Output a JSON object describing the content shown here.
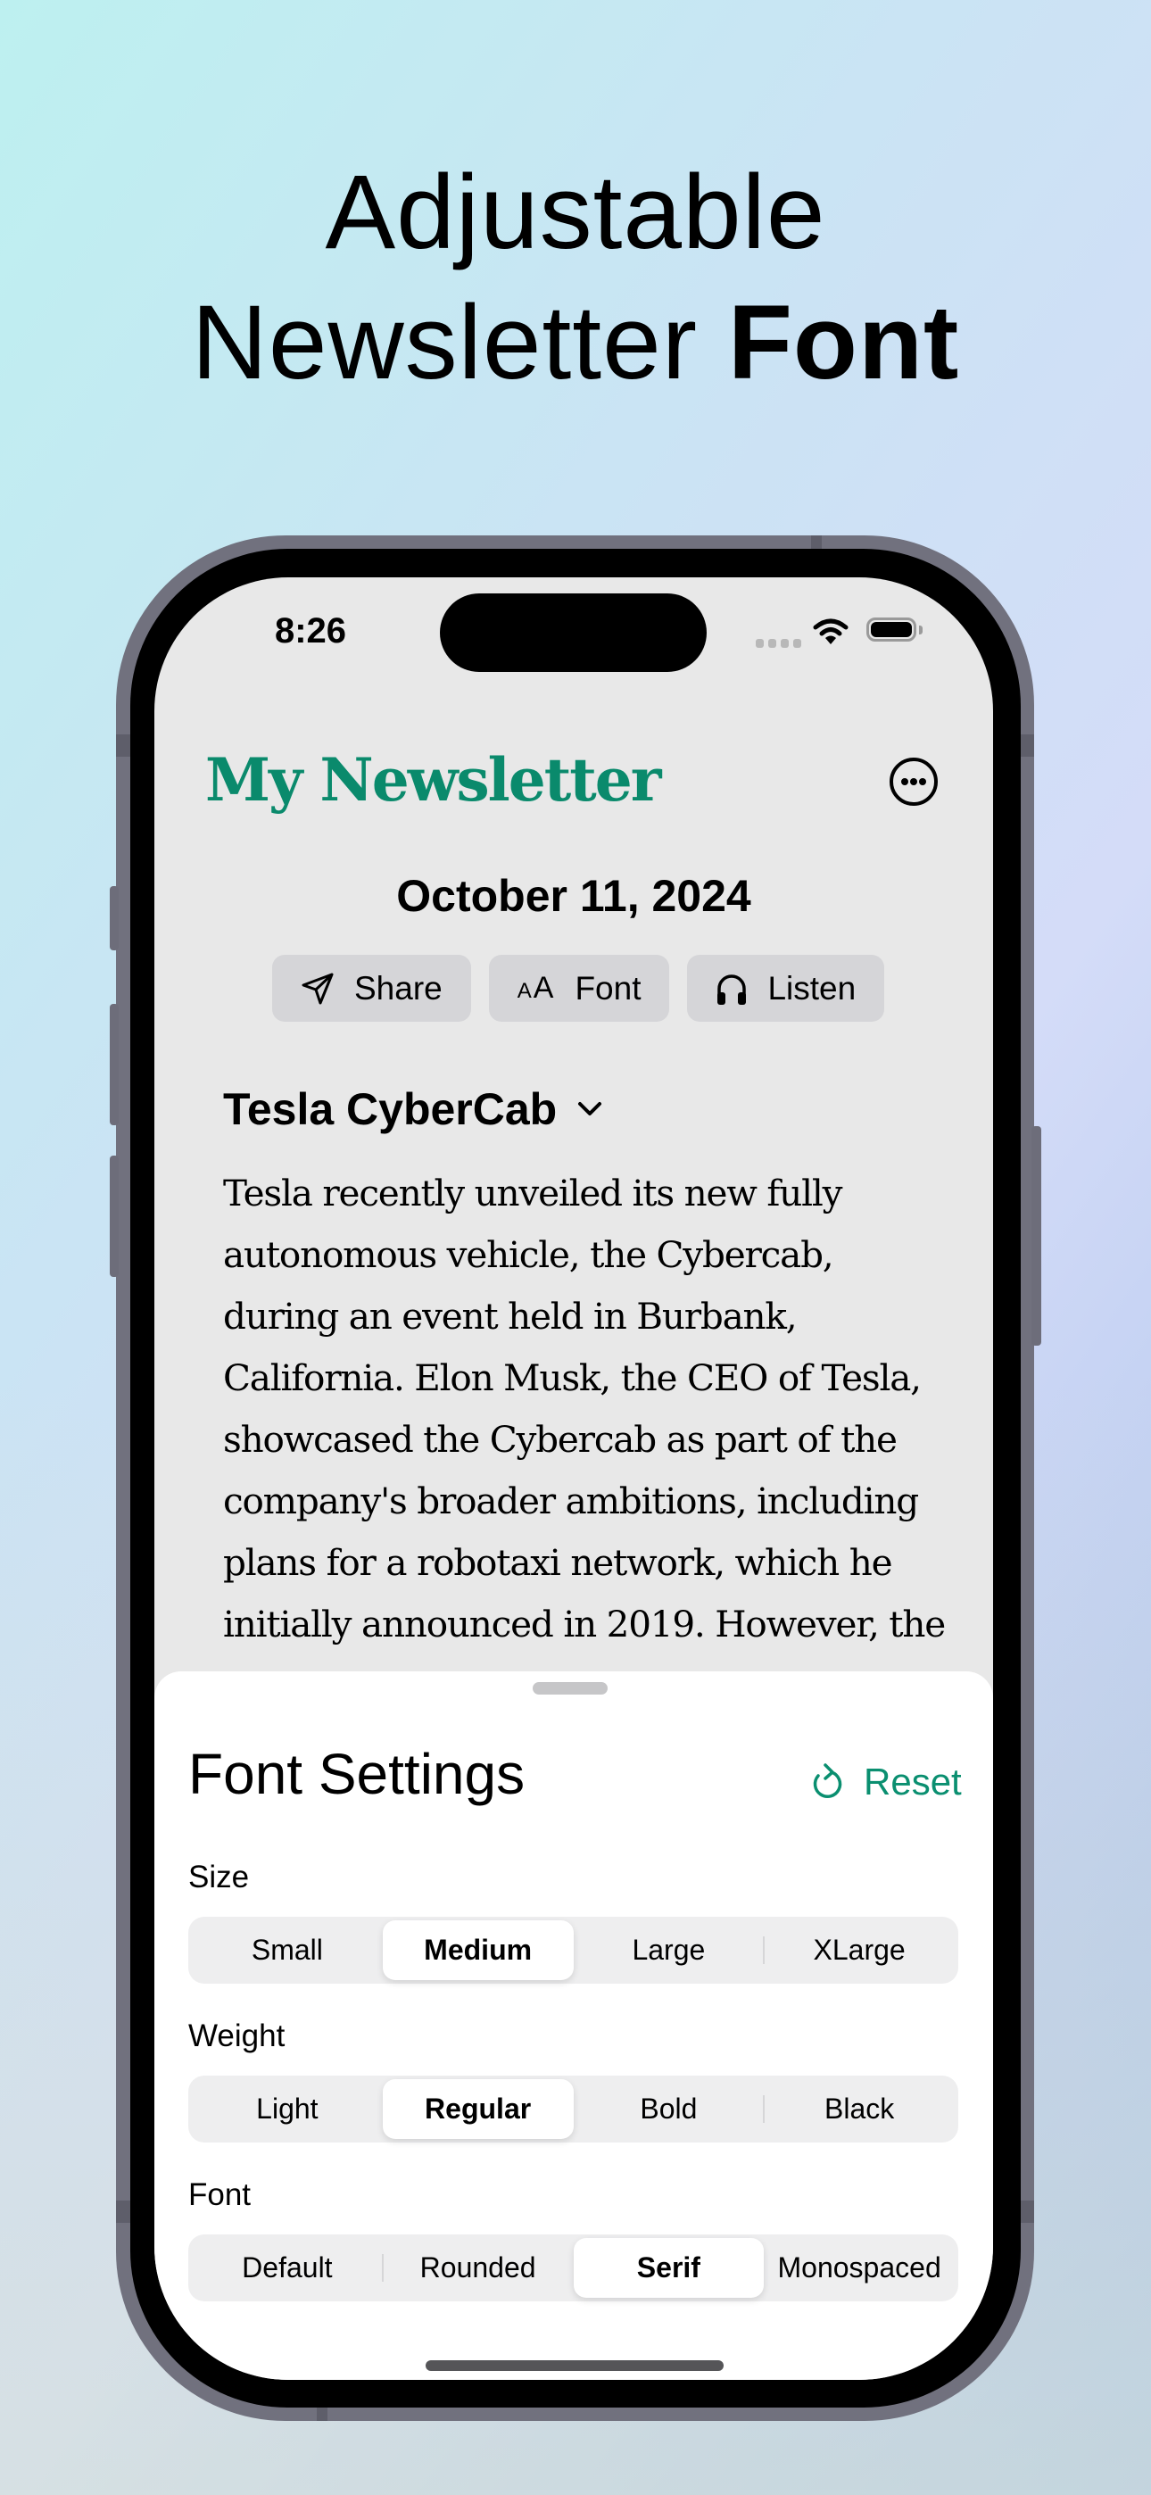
{
  "headline": {
    "line1": "Adjustable",
    "line2_regular": "Newsletter ",
    "line2_bold": "Font"
  },
  "status_bar": {
    "time": "8:26",
    "icons": [
      "cellular-signal-icon",
      "wifi-icon",
      "battery-icon"
    ]
  },
  "header": {
    "app_title": "My Newsletter",
    "more_icon": "ellipsis-circle-icon"
  },
  "date": "October 11, 2024",
  "actions": [
    {
      "label": "Share",
      "icon": "paper-plane-icon"
    },
    {
      "label": "Font",
      "icon": "textformat-size-icon",
      "icon_text_small": "A",
      "icon_text_large": "A"
    },
    {
      "label": "Listen",
      "icon": "headphones-icon"
    }
  ],
  "story": {
    "title": "Tesla CyberCab",
    "expand_icon": "chevron-down-icon",
    "body": "Tesla recently unveiled its new fully autonomous vehicle, the Cybercab, during an event held in Burbank, California. Elon Musk, the CEO of Tesla, showcased the Cybercab as part of the company's broader ambitions, including plans for a robotaxi network, which he initially announced in 2019. However, the"
  },
  "font_settings": {
    "title": "Font Settings",
    "reset_label": "Reset",
    "accent_color": "#0a8f70",
    "sections": [
      {
        "label": "Size",
        "options": [
          "Small",
          "Medium",
          "Large",
          "XLarge"
        ],
        "selected": "Medium"
      },
      {
        "label": "Weight",
        "options": [
          "Light",
          "Regular",
          "Bold",
          "Black"
        ],
        "selected": "Regular"
      },
      {
        "label": "Font",
        "options": [
          "Default",
          "Rounded",
          "Serif",
          "Monospaced"
        ],
        "selected": "Serif"
      }
    ]
  }
}
